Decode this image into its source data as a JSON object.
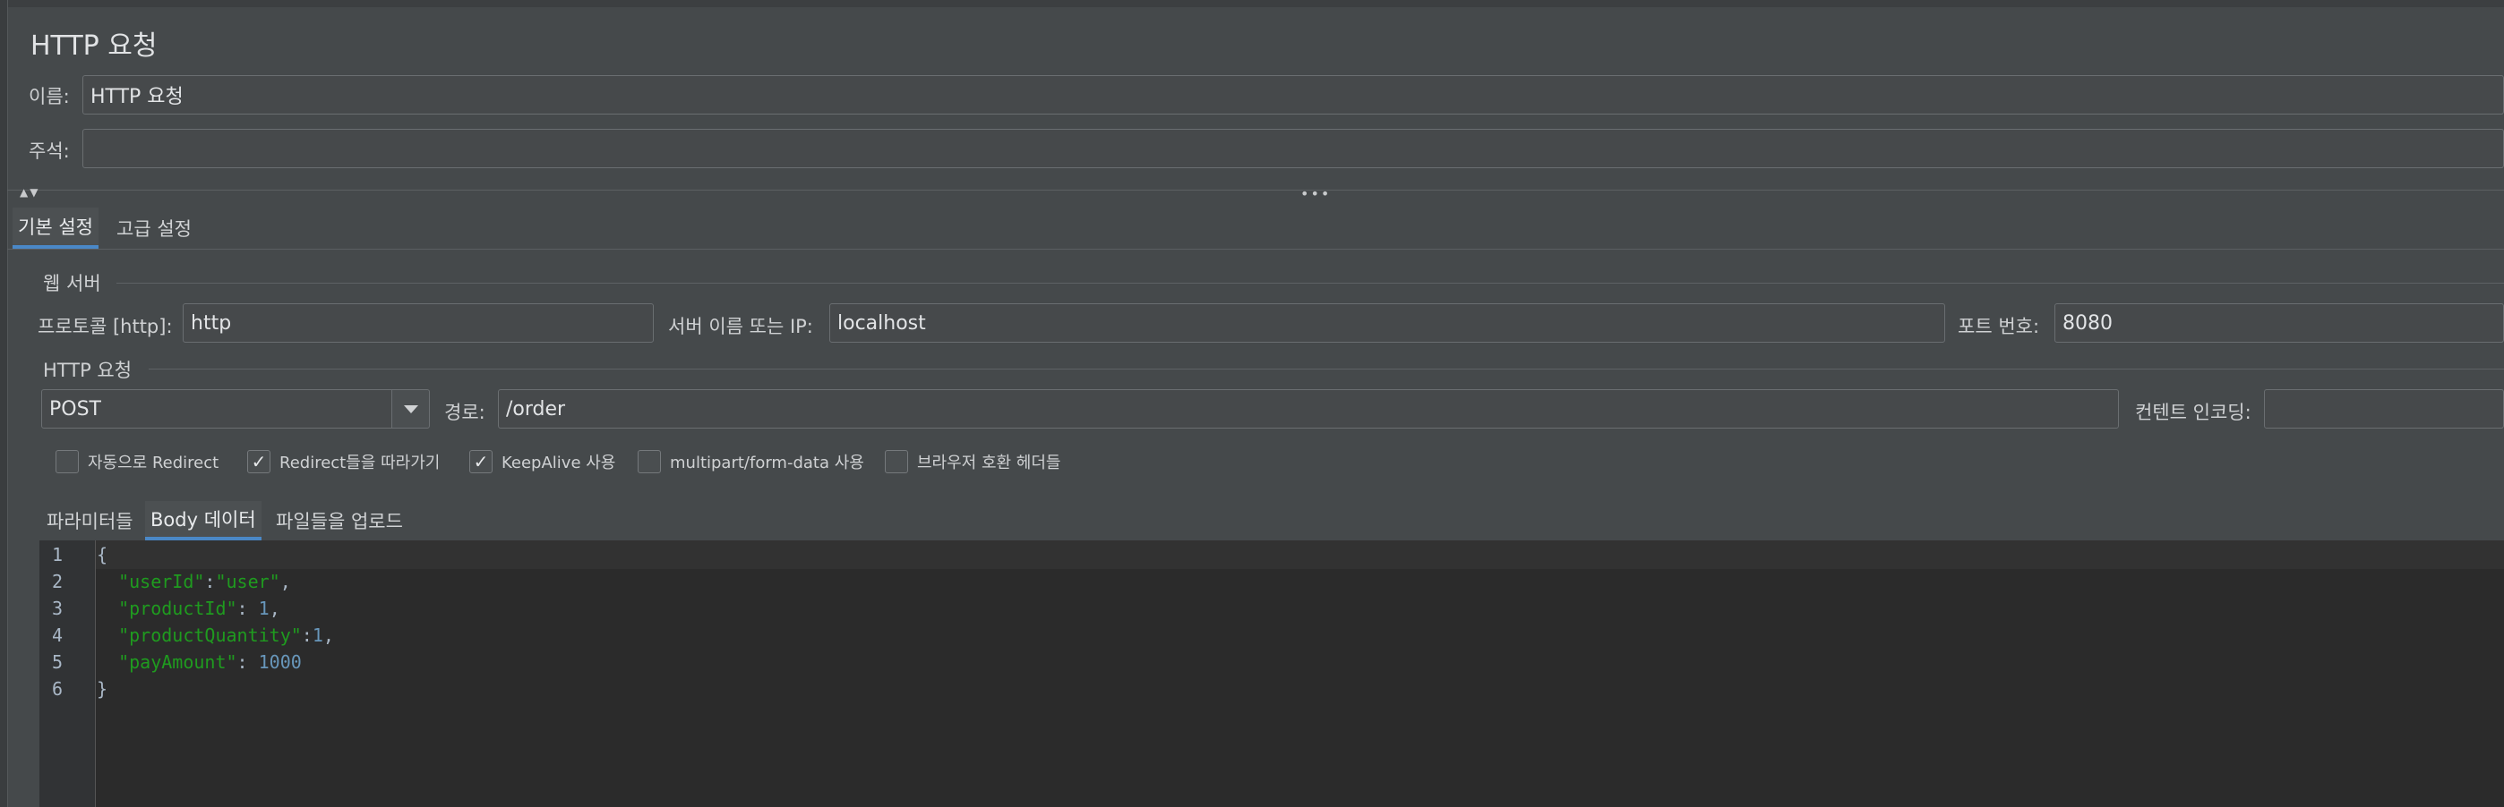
{
  "title": "HTTP 요청",
  "name": {
    "label": "이름:",
    "value": "HTTP 요청"
  },
  "comment": {
    "label": "주석:",
    "value": ""
  },
  "tabs": {
    "basic": "기본 설정",
    "advanced": "고급 설정"
  },
  "web_server": {
    "group_label": "웹 서버",
    "protocol_label": "프로토콜 [http]:",
    "protocol_value": "http",
    "server_label": "서버 이름 또는 IP:",
    "server_value": "localhost",
    "port_label": "포트 번호:",
    "port_value": "8080"
  },
  "http_request": {
    "group_label": "HTTP 요청",
    "method": "POST",
    "path_label": "경로:",
    "path_value": "/order",
    "encoding_label": "컨텐트 인코딩:",
    "encoding_value": ""
  },
  "options": [
    {
      "label": "자동으로 Redirect",
      "checked": false
    },
    {
      "label": "Redirect들을 따라가기",
      "checked": true
    },
    {
      "label": "KeepAlive 사용",
      "checked": true
    },
    {
      "label": "multipart/form-data 사용",
      "checked": false
    },
    {
      "label": "브라우저 호환 헤더들",
      "checked": false
    }
  ],
  "sub_tabs": {
    "params": "파라미터들",
    "body": "Body 데이터",
    "files": "파일들을 업로드"
  },
  "body_lines": [
    "1",
    "2",
    "3",
    "4",
    "5",
    "6"
  ],
  "body": {
    "l1": "{",
    "l2_key": "\"userId\"",
    "l2_sep": ":",
    "l2_val": "\"user\"",
    "l2_end": ",",
    "l3_key": "\"productId\"",
    "l3_sep": ": ",
    "l3_val": "1",
    "l3_end": ",",
    "l4_key": "\"productQuantity\"",
    "l4_sep": ":",
    "l4_val": "1",
    "l4_end": ",",
    "l5_key": "\"payAmount\"",
    "l5_sep": ": ",
    "l5_val": "1000",
    "l6": "}"
  },
  "icons": {
    "check": "check-icon",
    "dropdown": "chevron-down-icon",
    "split": "splitter-dots-icon"
  }
}
